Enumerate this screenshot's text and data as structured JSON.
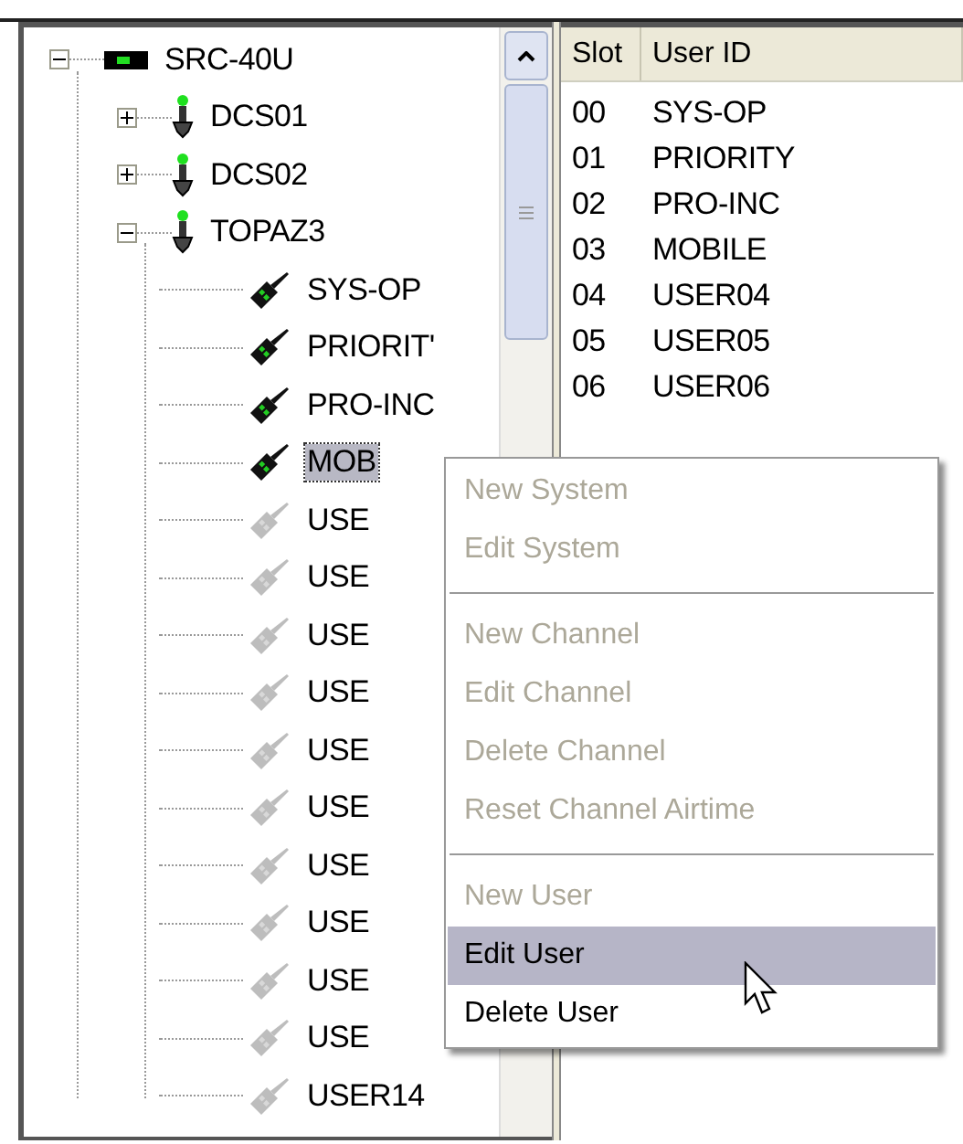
{
  "tree": {
    "items": [
      {
        "label": "SRC-40U",
        "kind": "controller",
        "expanded": true,
        "selected": false,
        "children": [
          {
            "label": "DCS01",
            "kind": "system",
            "expanded": false,
            "selected": false
          },
          {
            "label": "DCS02",
            "kind": "system",
            "expanded": false,
            "selected": false
          },
          {
            "label": "TOPAZ3",
            "kind": "system",
            "expanded": true,
            "selected": false,
            "children": [
              {
                "label": "SYS-OP",
                "kind": "user",
                "active": true,
                "selected": false
              },
              {
                "label": "PRIORIT'",
                "kind": "user",
                "active": true,
                "selected": false
              },
              {
                "label": "PRO-INC",
                "kind": "user",
                "active": true,
                "selected": false
              },
              {
                "label": "MOB",
                "kind": "user",
                "active": true,
                "selected": true
              },
              {
                "label": "USE",
                "kind": "user",
                "active": false,
                "selected": false
              },
              {
                "label": "USE",
                "kind": "user",
                "active": false,
                "selected": false
              },
              {
                "label": "USE",
                "kind": "user",
                "active": false,
                "selected": false
              },
              {
                "label": "USE",
                "kind": "user",
                "active": false,
                "selected": false
              },
              {
                "label": "USE",
                "kind": "user",
                "active": false,
                "selected": false
              },
              {
                "label": "USE",
                "kind": "user",
                "active": false,
                "selected": false
              },
              {
                "label": "USE",
                "kind": "user",
                "active": false,
                "selected": false
              },
              {
                "label": "USE",
                "kind": "user",
                "active": false,
                "selected": false
              },
              {
                "label": "USE",
                "kind": "user",
                "active": false,
                "selected": false
              },
              {
                "label": "USE",
                "kind": "user",
                "active": false,
                "selected": false
              },
              {
                "label": "USER14",
                "kind": "user",
                "active": false,
                "selected": false
              }
            ]
          }
        ]
      }
    ]
  },
  "table": {
    "columns": [
      "Slot",
      "User ID"
    ],
    "rows": [
      [
        "00",
        "SYS-OP"
      ],
      [
        "01",
        "PRIORITY"
      ],
      [
        "02",
        "PRO-INC"
      ],
      [
        "03",
        "MOBILE"
      ],
      [
        "04",
        "USER04"
      ],
      [
        "05",
        "USER05"
      ],
      [
        "06",
        "USER06"
      ]
    ]
  },
  "context_menu": {
    "items": [
      {
        "kind": "item",
        "label": "New System",
        "disabled": true,
        "selected": false
      },
      {
        "kind": "item",
        "label": "Edit System",
        "disabled": true,
        "selected": false
      },
      {
        "kind": "separator"
      },
      {
        "kind": "item",
        "label": "New Channel",
        "disabled": true,
        "selected": false
      },
      {
        "kind": "item",
        "label": "Edit Channel",
        "disabled": true,
        "selected": false
      },
      {
        "kind": "item",
        "label": "Delete Channel",
        "disabled": true,
        "selected": false
      },
      {
        "kind": "item",
        "label": "Reset Channel Airtime",
        "disabled": true,
        "selected": false
      },
      {
        "kind": "separator"
      },
      {
        "kind": "item",
        "label": "New User",
        "disabled": true,
        "selected": false
      },
      {
        "kind": "item",
        "label": "Edit User",
        "disabled": false,
        "selected": true
      },
      {
        "kind": "item",
        "label": "Delete User",
        "disabled": false,
        "selected": false
      }
    ]
  }
}
